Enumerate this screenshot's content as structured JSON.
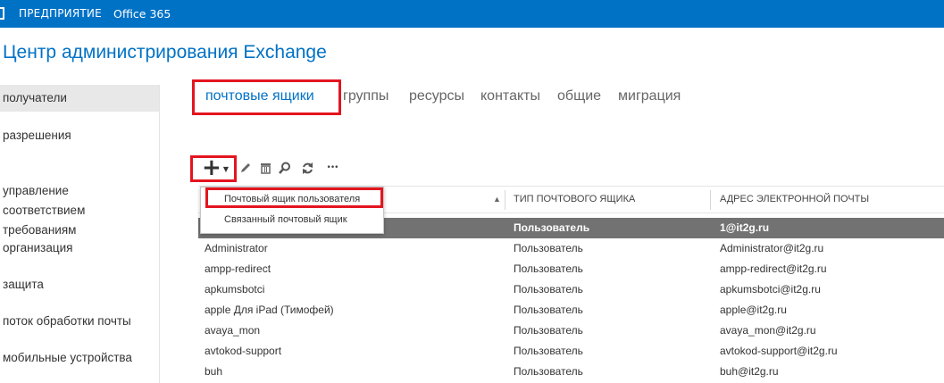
{
  "topbar": {
    "enterprise": "ПРЕДПРИЯТИЕ",
    "office": "Office 365"
  },
  "app": {
    "title": "Центр администрирования Exchange"
  },
  "sidebar": {
    "items": [
      {
        "label": "получатели",
        "active": true
      },
      {
        "label": "разрешения"
      },
      {
        "label": "управление\nсоответствием\nтребованиям"
      },
      {
        "label": "организация"
      },
      {
        "label": "защита"
      },
      {
        "label": "поток обработки почты"
      },
      {
        "label": "мобильные устройства"
      }
    ]
  },
  "tabs": [
    {
      "label": "почтовые ящики",
      "active": true
    },
    {
      "label": "группы"
    },
    {
      "label": "ресурсы"
    },
    {
      "label": "контакты"
    },
    {
      "label": "общие"
    },
    {
      "label": "миграция"
    }
  ],
  "toolbar": {
    "add": "+",
    "more": "•••"
  },
  "add_menu": {
    "items": [
      "Почтовый ящик пользователя",
      "Связанный почтовый ящик"
    ]
  },
  "grid": {
    "columns": [
      "",
      "ТИП ПОЧТОВОГО ЯЩИКА",
      "АДРЕС ЭЛЕКТРОННОЙ ПОЧТЫ"
    ],
    "rows": [
      [
        "",
        "Пользователь",
        "1@it2g.ru"
      ],
      [
        "Administrator",
        "Пользователь",
        "Administrator@it2g.ru"
      ],
      [
        "ampp-redirect",
        "Пользователь",
        "ampp-redirect@it2g.ru"
      ],
      [
        "apkumsbotci",
        "Пользователь",
        "apkumsbotci@it2g.ru"
      ],
      [
        "apple Для iPad (Тимофей)",
        "Пользователь",
        "apple@it2g.ru"
      ],
      [
        "avaya_mon",
        "Пользователь",
        "avaya_mon@it2g.ru"
      ],
      [
        "avtokod-support",
        "Пользователь",
        "avtokod-support@it2g.ru"
      ],
      [
        "buh",
        "Пользователь",
        "buh@it2g.ru"
      ]
    ]
  },
  "colors": {
    "brand": "#0072c6",
    "highlight": "#e3151f",
    "selected_row": "#727272"
  }
}
